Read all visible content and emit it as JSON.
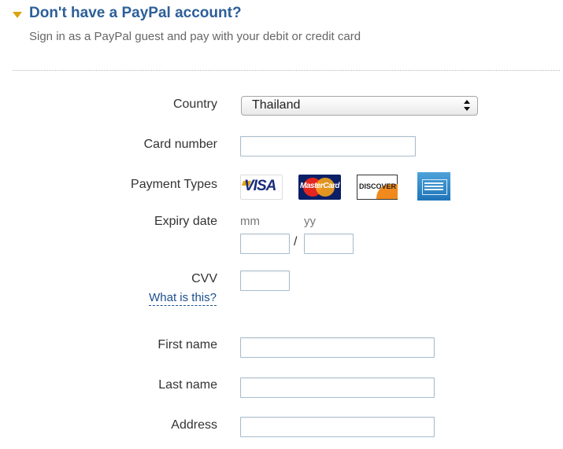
{
  "header": {
    "title": "Don't have a PayPal account?",
    "subtitle": "Sign in as a PayPal guest and pay with your debit or credit card",
    "toggle_icon": "triangle-down-icon",
    "accent_color": "#d9a412",
    "title_color": "#2c5f99"
  },
  "form": {
    "country": {
      "label": "Country",
      "value": "Thailand"
    },
    "card_number": {
      "label": "Card number",
      "value": ""
    },
    "payment_types": {
      "label": "Payment Types",
      "cards": [
        {
          "name": "visa-logo",
          "text": "VISA"
        },
        {
          "name": "mastercard-logo",
          "text": "MasterCard"
        },
        {
          "name": "discover-logo",
          "text": "DISCOVER"
        },
        {
          "name": "amex-logo",
          "text": ""
        }
      ]
    },
    "expiry": {
      "label": "Expiry date",
      "month_hint": "mm",
      "year_hint": "yy",
      "separator": "/",
      "month_value": "",
      "year_value": ""
    },
    "cvv": {
      "label": "CVV",
      "help_link": "What is this?",
      "value": ""
    },
    "first_name": {
      "label": "First name",
      "value": ""
    },
    "last_name": {
      "label": "Last name",
      "value": ""
    },
    "address": {
      "label": "Address",
      "value": ""
    }
  }
}
